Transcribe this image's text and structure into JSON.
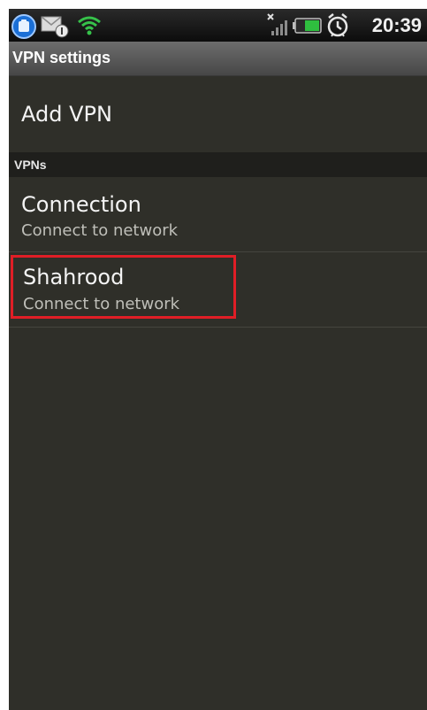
{
  "status_bar": {
    "time": "20:39",
    "icons": [
      "app-icon",
      "mail-notification-icon",
      "wifi-icon",
      "signal-icon",
      "battery-icon",
      "alarm-icon"
    ]
  },
  "title_bar": {
    "title": "VPN settings"
  },
  "add_vpn": {
    "label": "Add VPN"
  },
  "section": {
    "label": "VPNs"
  },
  "vpns": [
    {
      "name": "Connection",
      "summary": "Connect to network"
    },
    {
      "name": "Shahrood",
      "summary": "Connect to network"
    }
  ],
  "colors": {
    "background": "#2f2f29",
    "title_bar": "#5a5a5a",
    "section_header": "#1f1f1c",
    "highlight_border": "#e01e26",
    "primary_text": "#f4f4f4",
    "secondary_text": "#bfbfb9"
  }
}
